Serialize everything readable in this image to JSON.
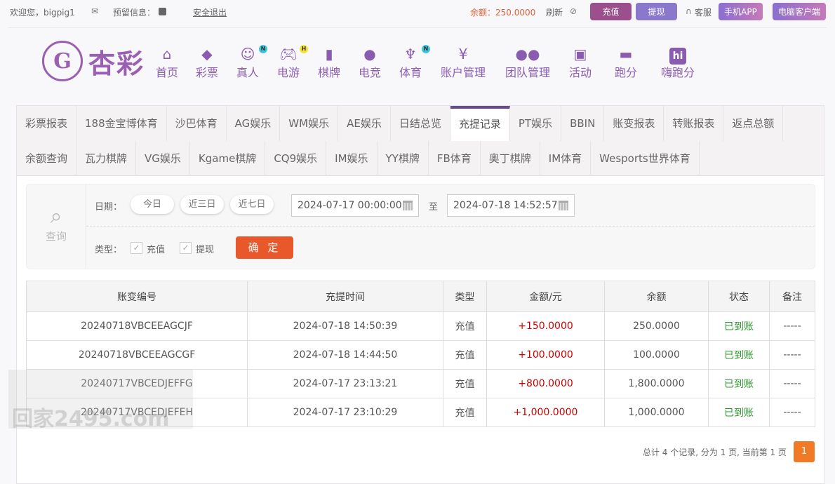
{
  "topbar": {
    "welcome": "欢迎您，bigpig1",
    "reserved_info": "预留信息：",
    "logout": "安全退出",
    "balance": "余额：250.0000",
    "refresh": "刷新",
    "deposit": "充值",
    "withdraw": "提现",
    "service": "客服",
    "mobile_app": "手机APP",
    "pc_client": "电脑客户端"
  },
  "logo": {
    "text": "杏彩"
  },
  "nav": [
    {
      "label": "首页",
      "icon": "home-icon"
    },
    {
      "label": "彩票",
      "icon": "ticket-icon"
    },
    {
      "label": "真人",
      "icon": "dealer-icon",
      "badge": "N"
    },
    {
      "label": "电游",
      "icon": "gamepad-icon",
      "badge": "H"
    },
    {
      "label": "棋牌",
      "icon": "cards-icon"
    },
    {
      "label": "电竞",
      "icon": "gamepad-icon"
    },
    {
      "label": "体育",
      "icon": "trophy-icon",
      "badge": "N"
    },
    {
      "label": "账户管理",
      "icon": "yen-icon"
    },
    {
      "label": "团队管理",
      "icon": "team-icon"
    },
    {
      "label": "活动",
      "icon": "gift-icon"
    },
    {
      "label": "跑分",
      "icon": "rhino-icon"
    },
    {
      "label": "嗨跑分",
      "icon": "hi-icon"
    }
  ],
  "tabs_row1": [
    "彩票报表",
    "188金宝博体育",
    "沙巴体育",
    "AG娱乐",
    "WM娱乐",
    "AE娱乐",
    "日结总览",
    "充提记录",
    "PT娱乐",
    "BBIN",
    "账变报表",
    "转账报表",
    "返点总额"
  ],
  "tabs_row2": [
    "余额查询",
    "瓦力棋牌",
    "VG娱乐",
    "Kgame棋牌",
    "CQ9娱乐",
    "IM娱乐",
    "YY棋牌",
    "FB体育",
    "奥丁棋牌",
    "IM体育",
    "Wesports世界体育"
  ],
  "active_tab": "充提记录",
  "query": {
    "title": "查询",
    "date_label": "日期：",
    "today": "今日",
    "three_days": "近三日",
    "seven_days": "近七日",
    "start": "2024-07-17 00:00:00",
    "to": "至",
    "end": "2024-07-18 14:52:57",
    "type_label": "类型：",
    "deposit": "充值",
    "withdraw": "提现",
    "confirm": "确 定"
  },
  "table": {
    "headers": [
      "账变编号",
      "充提时间",
      "类型",
      "金额/元",
      "余额",
      "状态",
      "备注"
    ],
    "rows": [
      [
        "20240718VBCEEAGCJF",
        "2024-07-18 14:50:39",
        "充值",
        "+150.0000",
        "250.0000",
        "已到账",
        "-----"
      ],
      [
        "20240718VBCEEAGCGF",
        "2024-07-18 14:44:50",
        "充值",
        "+100.0000",
        "100.0000",
        "已到账",
        "-----"
      ],
      [
        "20240717VBCEDJEFFG",
        "2024-07-17 23:13:21",
        "充值",
        "+800.0000",
        "1,800.0000",
        "已到账",
        "-----"
      ],
      [
        "20240717VBCEDJEFEH",
        "2024-07-17 23:10:29",
        "充值",
        "+1,000.0000",
        "1,000.0000",
        "已到账",
        "-----"
      ]
    ]
  },
  "pager": {
    "summary": "总计 4 个记录, 分为 1 页, 当前第 1 页",
    "page": "1"
  },
  "watermark": "回家2495.com"
}
